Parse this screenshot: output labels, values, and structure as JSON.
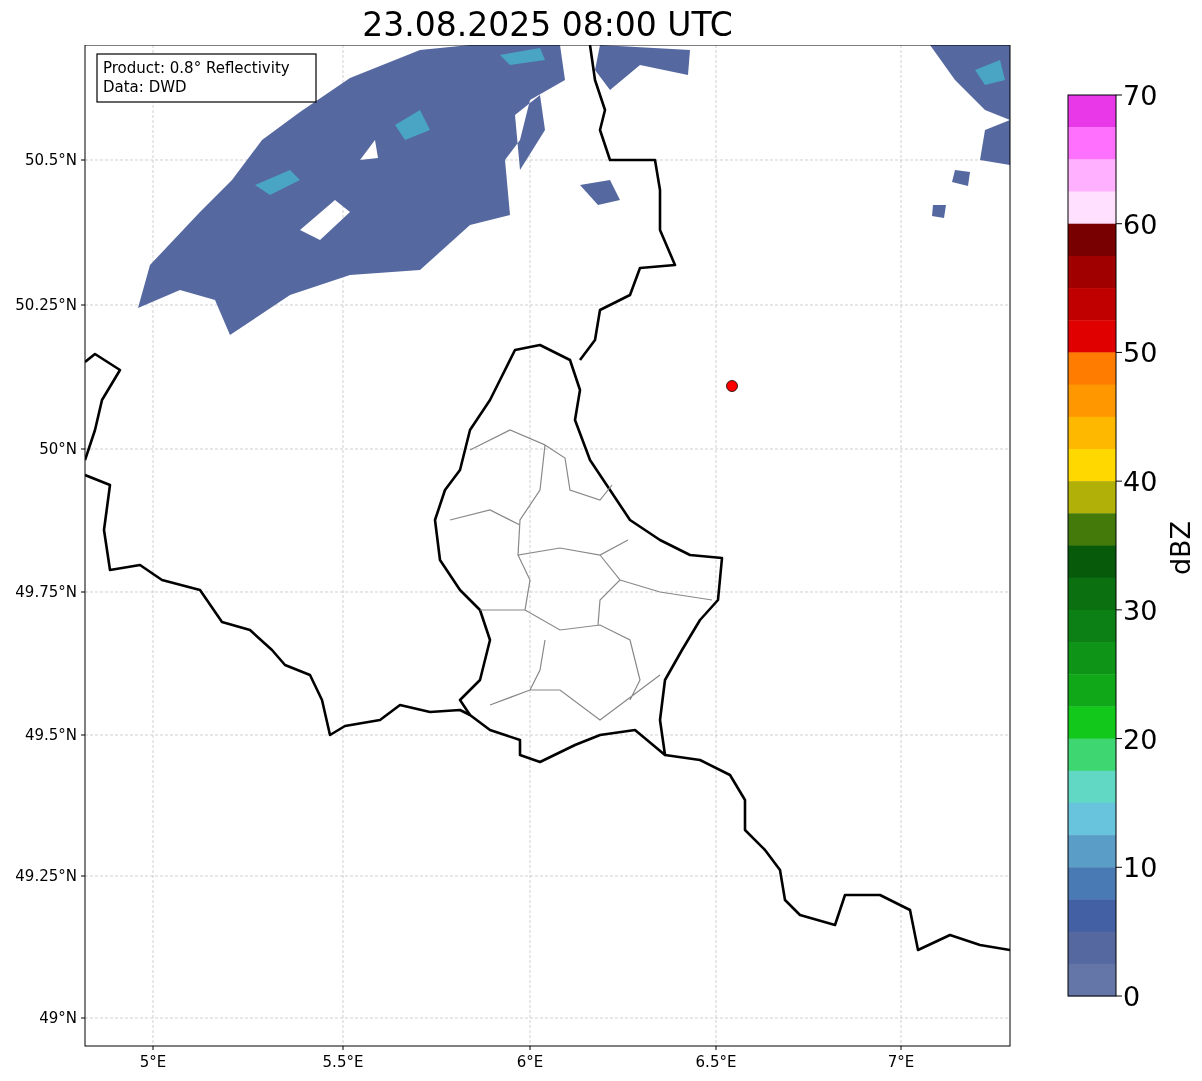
{
  "title": "23.08.2025 08:00 UTC",
  "info_box": [
    "Product: 0.8° Reflectivity",
    "Data: DWD"
  ],
  "map": {
    "x_ticks": [
      "5°E",
      "5.5°E",
      "6°E",
      "6.5°E",
      "7°E"
    ],
    "y_ticks": [
      "50.5°N",
      "50.25°N",
      "50°N",
      "49.75°N",
      "49.5°N",
      "49.25°N",
      "49°N"
    ]
  },
  "colorbar": {
    "label": "dBZ",
    "ticks": [
      "70",
      "60",
      "50",
      "40",
      "30",
      "20",
      "10",
      "0"
    ],
    "bins": [
      {
        "color": "#e838e8"
      },
      {
        "color": "#ff70ff"
      },
      {
        "color": "#ffb0ff"
      },
      {
        "color": "#ffe0ff"
      },
      {
        "color": "#780000"
      },
      {
        "color": "#a00000"
      },
      {
        "color": "#c00000"
      },
      {
        "color": "#e00000"
      },
      {
        "color": "#ff7c00"
      },
      {
        "color": "#ff9800"
      },
      {
        "color": "#ffb800"
      },
      {
        "color": "#ffd800"
      },
      {
        "color": "#b0b008"
      },
      {
        "color": "#447a0a"
      },
      {
        "color": "#065a0a"
      },
      {
        "color": "#0a7010"
      },
      {
        "color": "#0c8014"
      },
      {
        "color": "#0e9416"
      },
      {
        "color": "#10a818"
      },
      {
        "color": "#12c81a"
      },
      {
        "color": "#3dd670"
      },
      {
        "color": "#60d8c4"
      },
      {
        "color": "#68c4dc"
      },
      {
        "color": "#5a9ec8"
      },
      {
        "color": "#4a7ab4"
      },
      {
        "color": "#4460a4"
      },
      {
        "color": "#5568a0"
      },
      {
        "color": "#6475a8"
      }
    ]
  }
}
